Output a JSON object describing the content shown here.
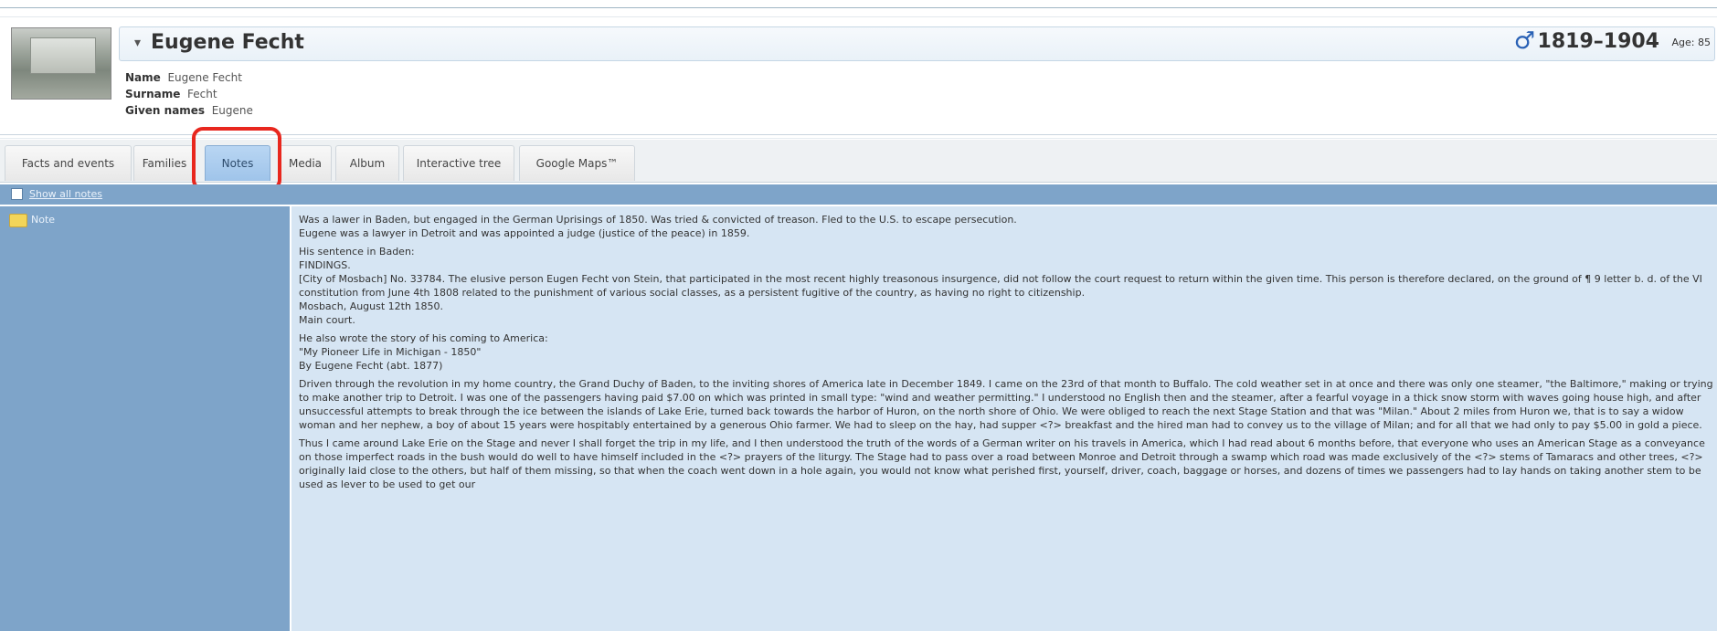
{
  "person": {
    "name": "Eugene Fecht",
    "lifespan": "1819–1904",
    "age_label": "Age:",
    "age_value": "85",
    "gender_icon": "male-icon",
    "photo_icon": "gravestone-photo"
  },
  "name_details": {
    "name_label": "Name",
    "name_value": "Eugene Fecht",
    "surname_label": "Surname",
    "surname_value": "Fecht",
    "given_label": "Given names",
    "given_value": "Eugene"
  },
  "tabs": [
    {
      "label": "Facts and events"
    },
    {
      "label": "Families"
    },
    {
      "label": "Notes",
      "active": true
    },
    {
      "label": "Media"
    },
    {
      "label": "Album"
    },
    {
      "label": "Interactive tree"
    },
    {
      "label": "Google Maps™"
    }
  ],
  "notes": {
    "show_all_label": "Show all notes",
    "note_label": "Note",
    "paragraphs": [
      "Was a lawer in Baden, but engaged in the German Uprisings of 1850.  Was tried & convicted of treason.  Fled to the U.S. to escape persecution.\nEugene was a lawyer in Detroit and was appointed a judge (justice of the peace) in 1859.",
      "His sentence in Baden:\nFINDINGS.\n[City of Mosbach] No. 33784. The elusive person Eugen Fecht von Stein, that participated in the most recent highly treasonous insurgence, did not follow the court request to return within the given time. This person is therefore declared, on the ground of ¶ 9 letter b. d. of the VI constitution from June 4th 1808 related to the punishment of various social classes, as a persistent fugitive of the country, as having no right to citizenship.\nMosbach, August 12th 1850.\nMain court.",
      "He also wrote the story of his coming to America:\n\"My Pioneer Life in Michigan - 1850\"\nBy Eugene Fecht (abt. 1877)",
      "Driven through the revolution in my home country, the Grand Duchy of Baden, to the inviting shores of America late in December 1849.  I came on the 23rd of that month to Buffalo.  The cold weather set in at once and there was only one steamer, \"the Baltimore,\" making or trying to make another trip to Detroit.  I was one of the passengers having paid $7.00 on which was printed in small type: \"wind and weather permitting.\"  I understood no English then and the steamer, after a fearful voyage in a thick snow storm with waves going house high, and after unsuccessful attempts to break through the ice between the islands of Lake Erie, turned back towards the harbor of Huron, on the north shore of Ohio.  We were obliged to reach the next Stage Station and that was \"Milan.\"  About 2 miles from Huron we, that is to say a widow woman and her nephew, a boy of about 15 years were hospitably entertained by a generous Ohio farmer.  We had to sleep on the hay, had supper <?> breakfast and the hired man had to convey us to the village of Milan; and for all that we had only to pay $5.00 in gold a piece.",
      "Thus I came around Lake Erie on the Stage and never I shall forget the trip in my life, and I then understood the truth of the words of a German writer on his travels in America, which I had read about 6 months before, that everyone who uses an American Stage as a conveyance on those imperfect roads in the bush would do well to have himself included in the <?> prayers of the liturgy.  The Stage had to pass over a road between Monroe and Detroit through a swamp which road was made exclusively of the <?> stems of Tamaracs and other trees, <?> originally laid close to the others, but half of them missing, so that when the coach went down in a hole again, you would not know what perished first, yourself, driver, coach, baggage or horses, and dozens of times we passengers had to lay hands on taking another stem to be used as lever to be used to get our"
    ]
  },
  "colors": {
    "accent_blue": "#7ea4c9",
    "note_bg": "#d6e5f3",
    "active_tab": "#9fc4ea",
    "highlight_red": "#e8271e",
    "male_blue": "#2961b5"
  }
}
